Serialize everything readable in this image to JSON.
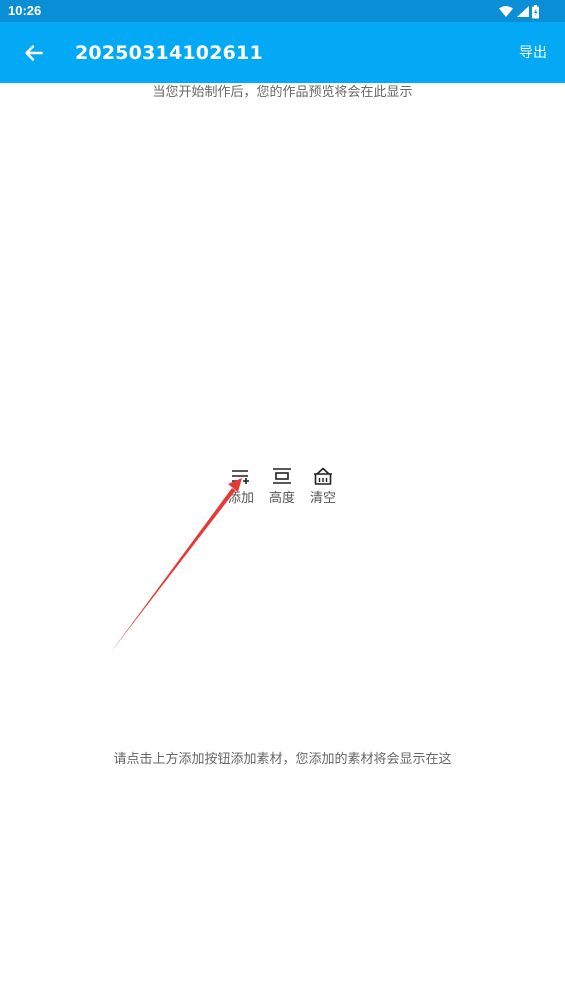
{
  "status_bar": {
    "time": "10:26",
    "icons": [
      "wifi-icon",
      "signal-icon",
      "battery-icon"
    ]
  },
  "app_bar": {
    "title": "20250314102611",
    "back_icon": "arrow-left-icon",
    "export_label": "导出"
  },
  "preview": {
    "hint": "当您开始制作后，您的作品预览将会在此显示"
  },
  "toolbar": {
    "items": [
      {
        "icon": "add-list-icon",
        "label": "添加"
      },
      {
        "icon": "height-icon",
        "label": "高度"
      },
      {
        "icon": "basket-clear-icon",
        "label": "清空"
      }
    ]
  },
  "materials": {
    "hint": "请点击上方添加按钮添加素材，您添加的素材将会显示在这"
  },
  "colors": {
    "status_bar": "#0a8fd6",
    "app_bar": "#03a9f4",
    "annotation_arrow": "#e53935"
  }
}
